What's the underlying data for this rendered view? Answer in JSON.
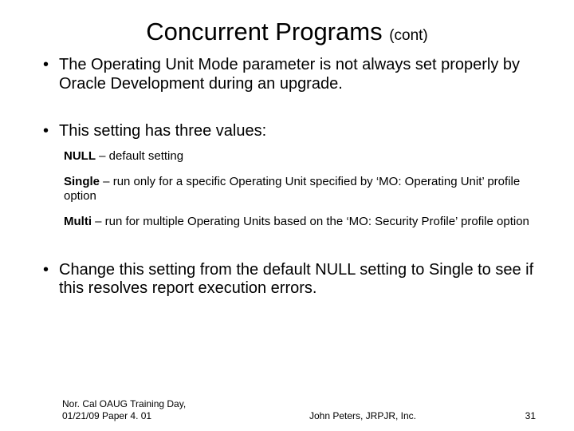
{
  "title": {
    "main": "Concurrent Programs ",
    "cont": "(cont)"
  },
  "bullets": {
    "b1": "The Operating Unit Mode parameter is not always set properly by Oracle Development during an upgrade.",
    "b2": "This setting has three values:",
    "b3": "Change this setting from the default NULL setting to Single to see if this resolves report execution errors."
  },
  "values": {
    "v1": {
      "name": "NULL",
      "desc": " – default setting"
    },
    "v2": {
      "name": "Single",
      "desc": " – run only for a specific Operating Unit specified by ‘MO: Operating Unit’ profile option"
    },
    "v3": {
      "name": "Multi",
      "desc": " – run for multiple Operating Units based on the ‘MO: Security Profile’ profile option"
    }
  },
  "footer": {
    "left": "Nor. Cal OAUG Training Day, 01/21/09 Paper 4. 01",
    "center": "John Peters, JRPJR, Inc.",
    "page": "31"
  }
}
